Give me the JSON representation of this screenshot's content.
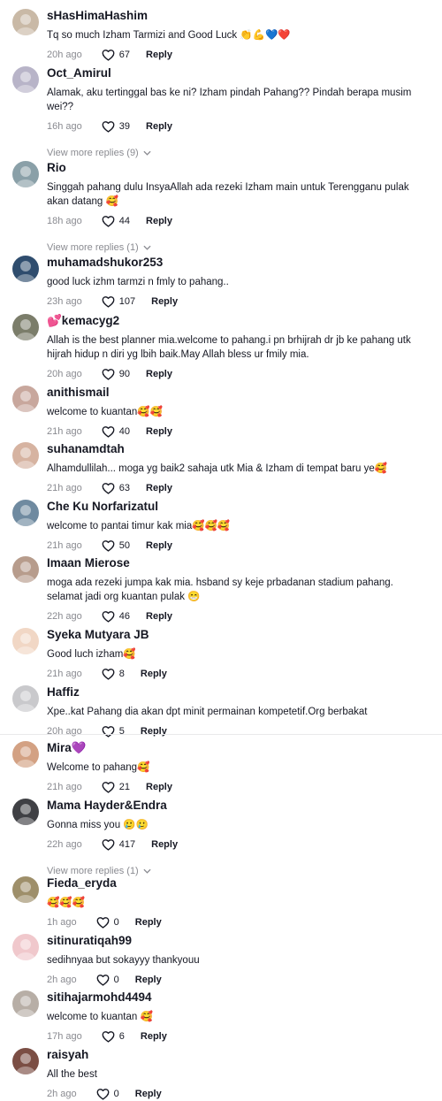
{
  "reply_label": "Reply",
  "colors": {
    "meta": "#8a8b91",
    "text": "#161823"
  },
  "comments": [
    {
      "username": "sHasHimaHashim",
      "text": "Tq so much Izham Tarmizi and Good Luck 👏💪💙❤️",
      "time": "20h ago",
      "likes": "67"
    },
    {
      "username": "Oct_Amirul",
      "text": "Alamak, aku tertinggal bas ke ni? Izham pindah Pahang?? Pindah berapa musim wei??",
      "time": "16h ago",
      "likes": "39",
      "more_replies": "View more replies (9)"
    },
    {
      "username": "Rio",
      "text": "Singgah pahang dulu InsyaAllah ada rezeki Izham main untuk Terengganu pulak akan datang 🥰",
      "time": "18h ago",
      "likes": "44",
      "more_replies": "View more replies (1)"
    },
    {
      "username": "muhamadshukor253",
      "text": "good luck izhm tarmzi n fmly to pahang..",
      "time": "23h ago",
      "likes": "107"
    },
    {
      "username": "💕kemacyg2",
      "text": "Allah is the best planner mia.welcome to pahang.i pn brhijrah dr jb ke pahang utk hijrah hidup n diri yg lbih baik.May Allah bless ur fmily mia.",
      "time": "20h ago",
      "likes": "90"
    },
    {
      "username": "anithismail",
      "text": "welcome to kuantan🥰🥰",
      "time": "21h ago",
      "likes": "40"
    },
    {
      "username": "suhanamdtah",
      "text": "Alhamdullilah... moga yg baik2 sahaja utk Mia & Izham di tempat baru ye🥰",
      "time": "21h ago",
      "likes": "63"
    },
    {
      "username": "Che Ku Norfarizatul",
      "text": "welcome to pantai timur kak mia🥰🥰🥰",
      "time": "21h ago",
      "likes": "50"
    },
    {
      "username": "Imaan Mierose",
      "text": "moga ada rezeki jumpa kak mia. hsband sy keje prbadanan stadium pahang. selamat jadi org kuantan pulak 😁",
      "time": "22h ago",
      "likes": "46"
    },
    {
      "username": "Syeka Mutyara JB",
      "text": "Good luch izham🥰",
      "time": "21h ago",
      "likes": "8"
    },
    {
      "username": "Haffiz",
      "text": "Xpe..kat Pahang dia akan dpt minit permainan kompetetif.Org berbakat",
      "time": "20h ago",
      "likes": "5"
    },
    {
      "username": "Mira💜",
      "text": "Welcome to pahang🥰",
      "time": "21h ago",
      "likes": "21"
    },
    {
      "username": "Mama Hayder&Endra",
      "text": "Gonna miss you 🥲🥲",
      "time": "22h ago",
      "likes": "417",
      "more_replies": "View more replies (1)"
    },
    {
      "username": "Fieda_eryda",
      "text": "🥰🥰🥰",
      "time": "1h ago",
      "likes": "0"
    },
    {
      "username": "sitinuratiqah99",
      "text": "sedihnyaa but sokayyy thankyouu",
      "time": "2h ago",
      "likes": "0"
    },
    {
      "username": "sitihajarmohd4494",
      "text": "welcome to kuantan 🥰",
      "time": "17h ago",
      "likes": "6"
    },
    {
      "username": "raisyah",
      "text": "All the best",
      "time": "2h ago",
      "likes": "0"
    }
  ]
}
